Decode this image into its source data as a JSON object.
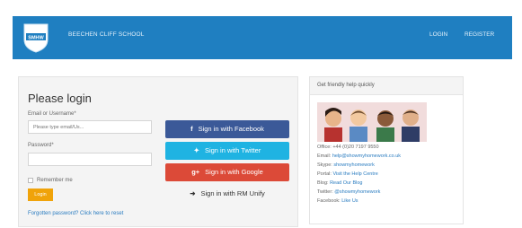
{
  "header": {
    "school_name": "BEECHEN CLIFF SCHOOL",
    "logo_text": "SMHW",
    "nav": {
      "login": "LOGIN",
      "register": "REGISTER"
    },
    "colors": {
      "bar": "#1f7fc1"
    }
  },
  "login": {
    "title": "Please login",
    "email_label": "Email or Username*",
    "email_placeholder": "Please type email/Us...",
    "password_label": "Password*",
    "remember_label": "Remember me",
    "login_button": "Login",
    "forgot_text": "Forgotten password? Click here to reset"
  },
  "social": {
    "facebook": {
      "label": "Sign in with Facebook",
      "icon": "facebook-icon",
      "color": "#3b5998"
    },
    "twitter": {
      "label": "Sign in with Twitter",
      "icon": "twitter-icon",
      "color": "#1fb3e2"
    },
    "google": {
      "label": "Sign in with Google",
      "icon": "google-plus-icon",
      "color": "#dc4a38"
    },
    "rm_unify": {
      "label": "Sign in with RM Unify",
      "icon": "sign-in-icon"
    }
  },
  "help": {
    "heading": "Get friendly help quickly",
    "lines": [
      {
        "label": "Office: ",
        "value": "+44 (0)20 7197 9550"
      },
      {
        "label": "Email: ",
        "value": "help@showmyhomework.co.uk"
      },
      {
        "label": "Skype: ",
        "value": "showmyhomework"
      },
      {
        "label": "Portal: ",
        "value": "Visit the Help Centre"
      },
      {
        "label": "Blog: ",
        "value": "Read Our Blog"
      },
      {
        "label": "Twitter: ",
        "value": "@showmyhomework"
      },
      {
        "label": "Facebook: ",
        "value": "Like Us"
      }
    ]
  }
}
